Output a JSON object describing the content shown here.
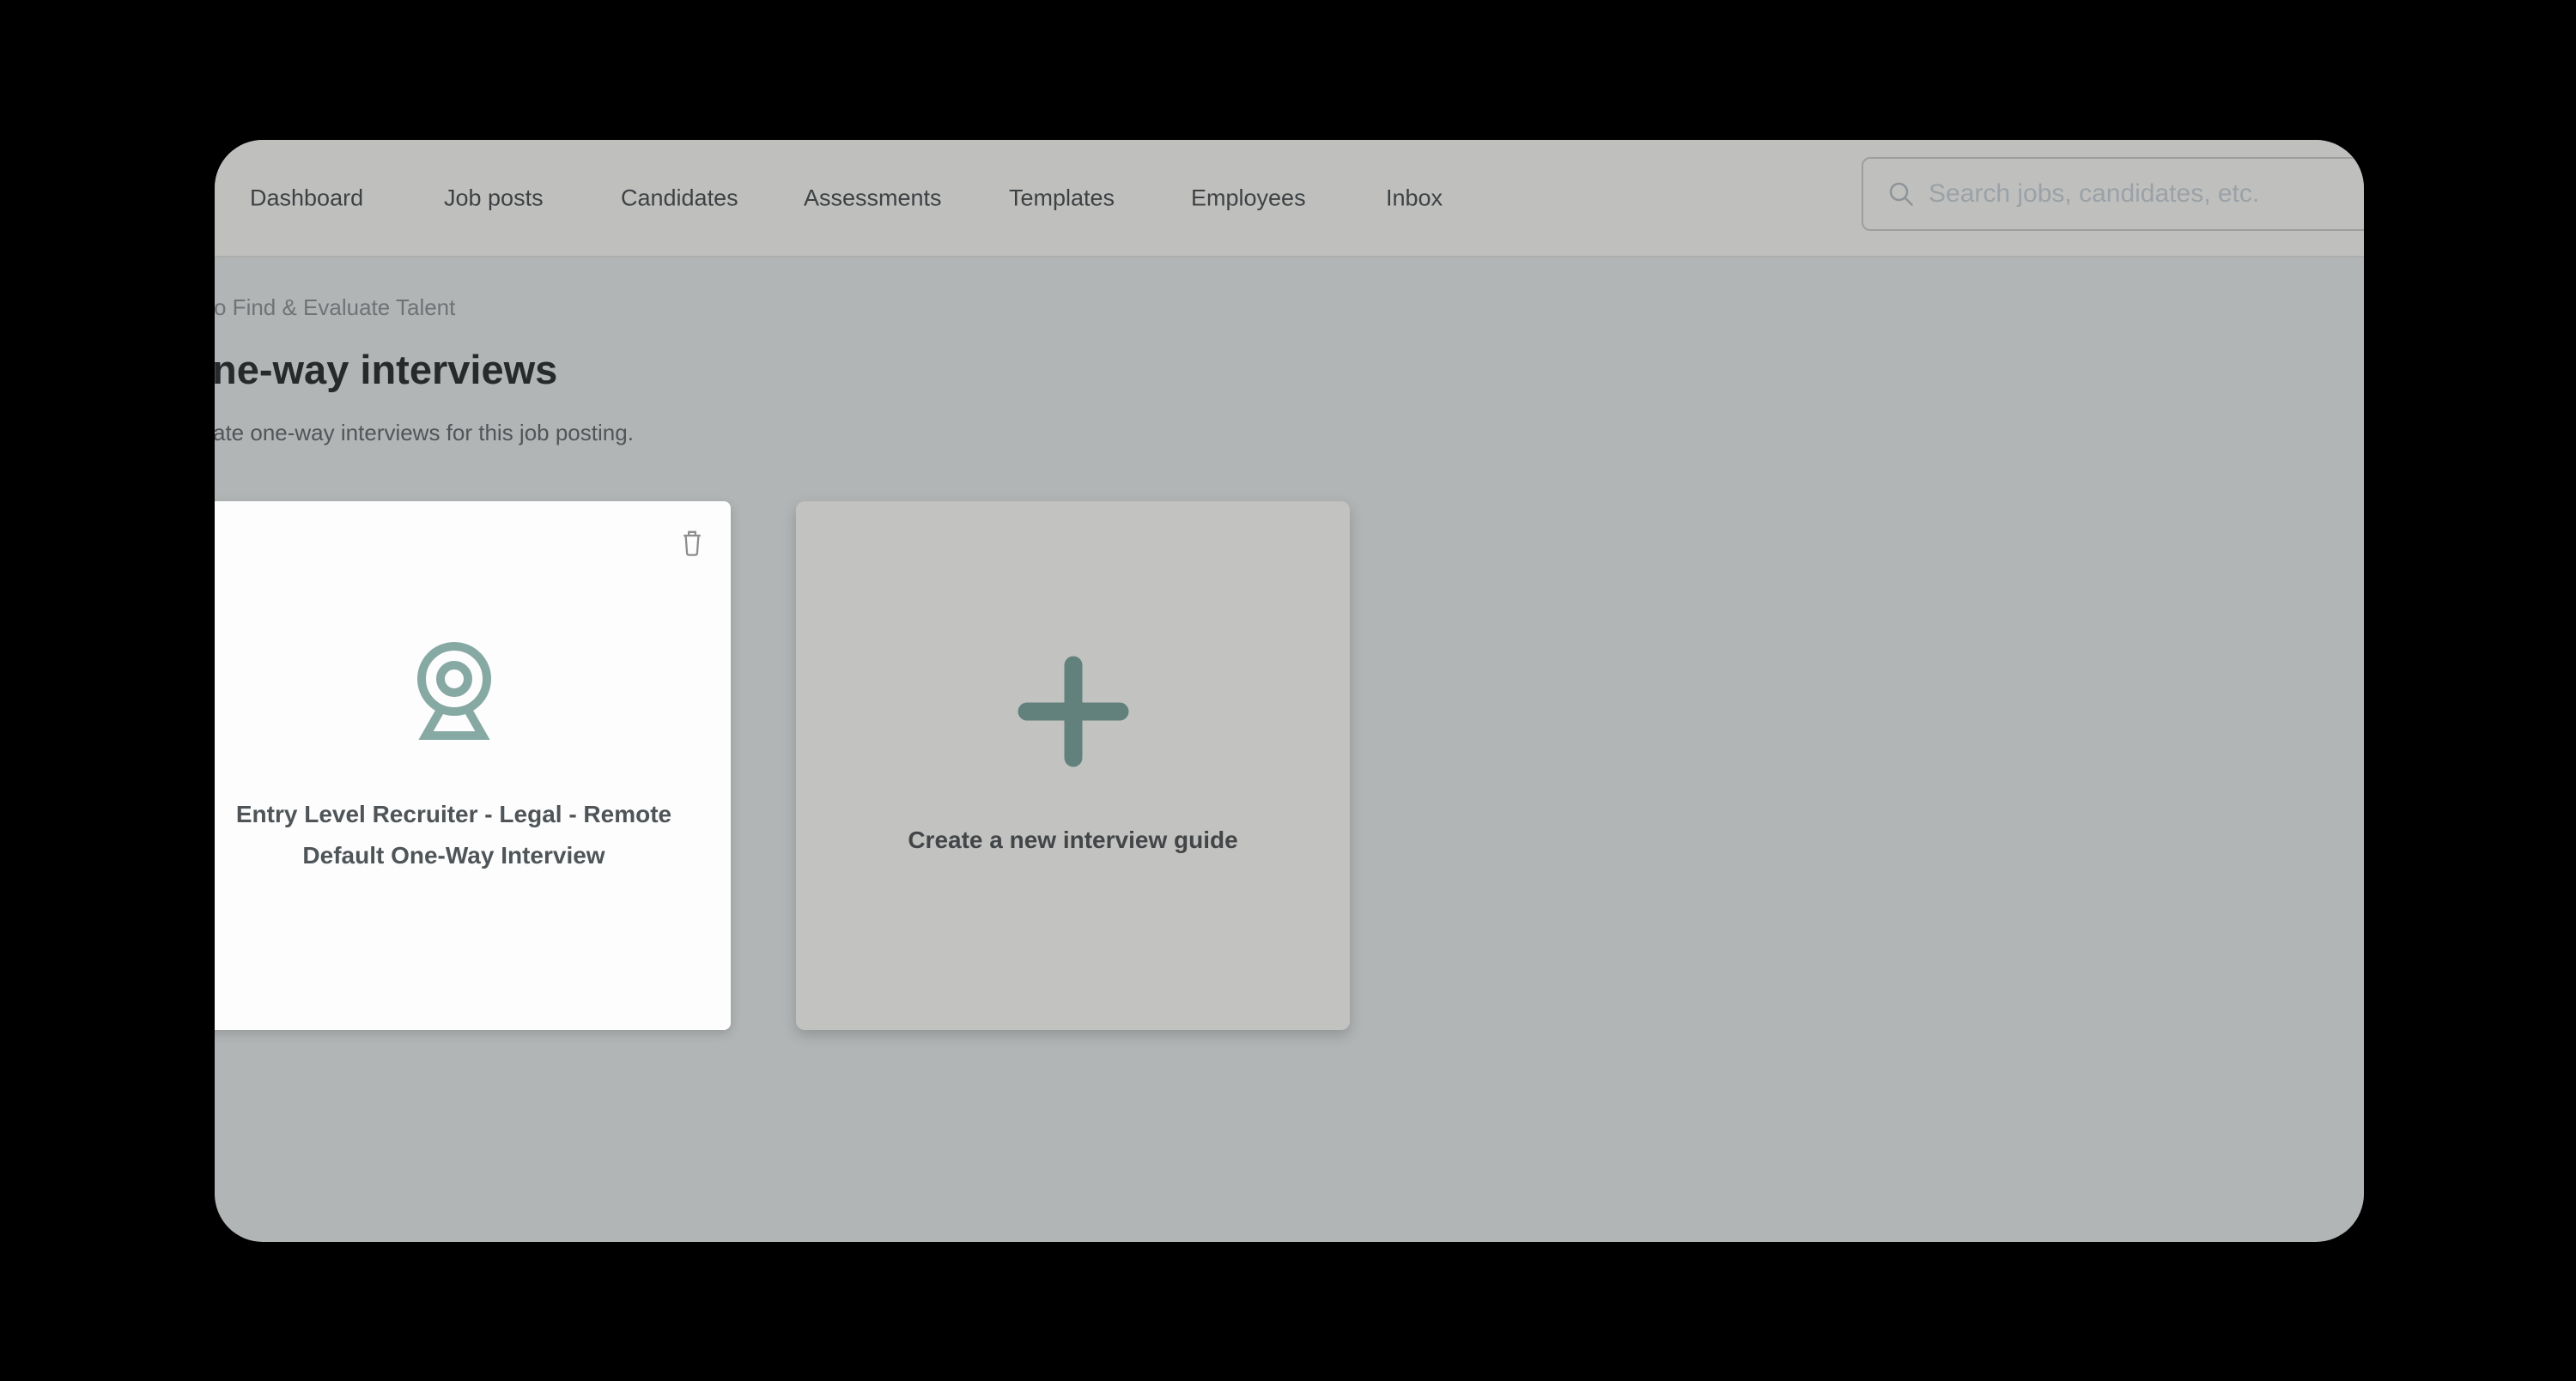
{
  "colors": {
    "surround": "#000000",
    "navbar-bg": "#bfc0be",
    "content-bg": "#b1b5b5",
    "card-bg": "#fdfdfd",
    "gray-card-bg": "#c2c2c0",
    "accent-teal": "#86a9a3",
    "accent-teal-dark": "#63817c",
    "nav-text": "#3e4144",
    "muted-text": "#6f7376",
    "heading-text": "#28292b",
    "subtitle-text": "#515558",
    "card-title-text": "#4e5457",
    "create-text": "#434648",
    "placeholder-text": "#9ba1a6",
    "search-border": "#9e9e9c",
    "trash-icon": "#8d8d8d"
  },
  "nav": {
    "items": [
      {
        "label": "Dashboard"
      },
      {
        "label": "Job posts"
      },
      {
        "label": "Candidates"
      },
      {
        "label": "Assessments"
      },
      {
        "label": "Templates"
      },
      {
        "label": "Employees"
      },
      {
        "label": "Inbox"
      }
    ]
  },
  "search": {
    "icon": "search-icon",
    "placeholder": "Search jobs, candidates, etc.",
    "value": ""
  },
  "page": {
    "breadcrumb_visible_text": "o Find & Evaluate Talent",
    "heading_visible_text": "ne-way interviews",
    "subtitle_visible_text": "ate one-way interviews for this job posting."
  },
  "cards": {
    "interview_guide": {
      "icon": "webcam-icon",
      "title_line1": "Entry Level Recruiter - Legal - Remote",
      "title_line2": "Default One-Way Interview",
      "action_icon": "trash-icon"
    },
    "create_guide": {
      "icon": "plus-icon",
      "label": "Create a new interview guide"
    }
  }
}
